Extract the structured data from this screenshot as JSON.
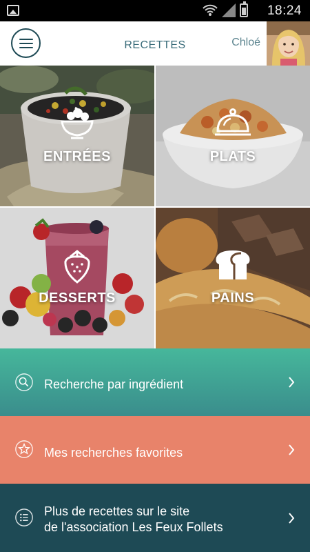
{
  "status_bar": {
    "time": "18:24"
  },
  "header": {
    "title": "RECETTES",
    "user_name": "Chloé"
  },
  "categories": [
    {
      "label": "ENTRÉES",
      "icon": "salad-bowl-icon"
    },
    {
      "label": "PLATS",
      "icon": "cloche-icon"
    },
    {
      "label": "DESSERTS",
      "icon": "strawberry-icon"
    },
    {
      "label": "PAINS",
      "icon": "bread-loaf-icon"
    }
  ],
  "actions": [
    {
      "label": "Recherche par ingrédient",
      "icon": "search-icon",
      "color": "#3d9c8c"
    },
    {
      "label": "Mes recherches favorites",
      "icon": "star-icon",
      "color": "#e8836a"
    },
    {
      "line1": "Plus de recettes sur le site",
      "line2": "de l'association Les Feux Follets",
      "icon": "list-icon",
      "color": "#1e4a55"
    }
  ]
}
